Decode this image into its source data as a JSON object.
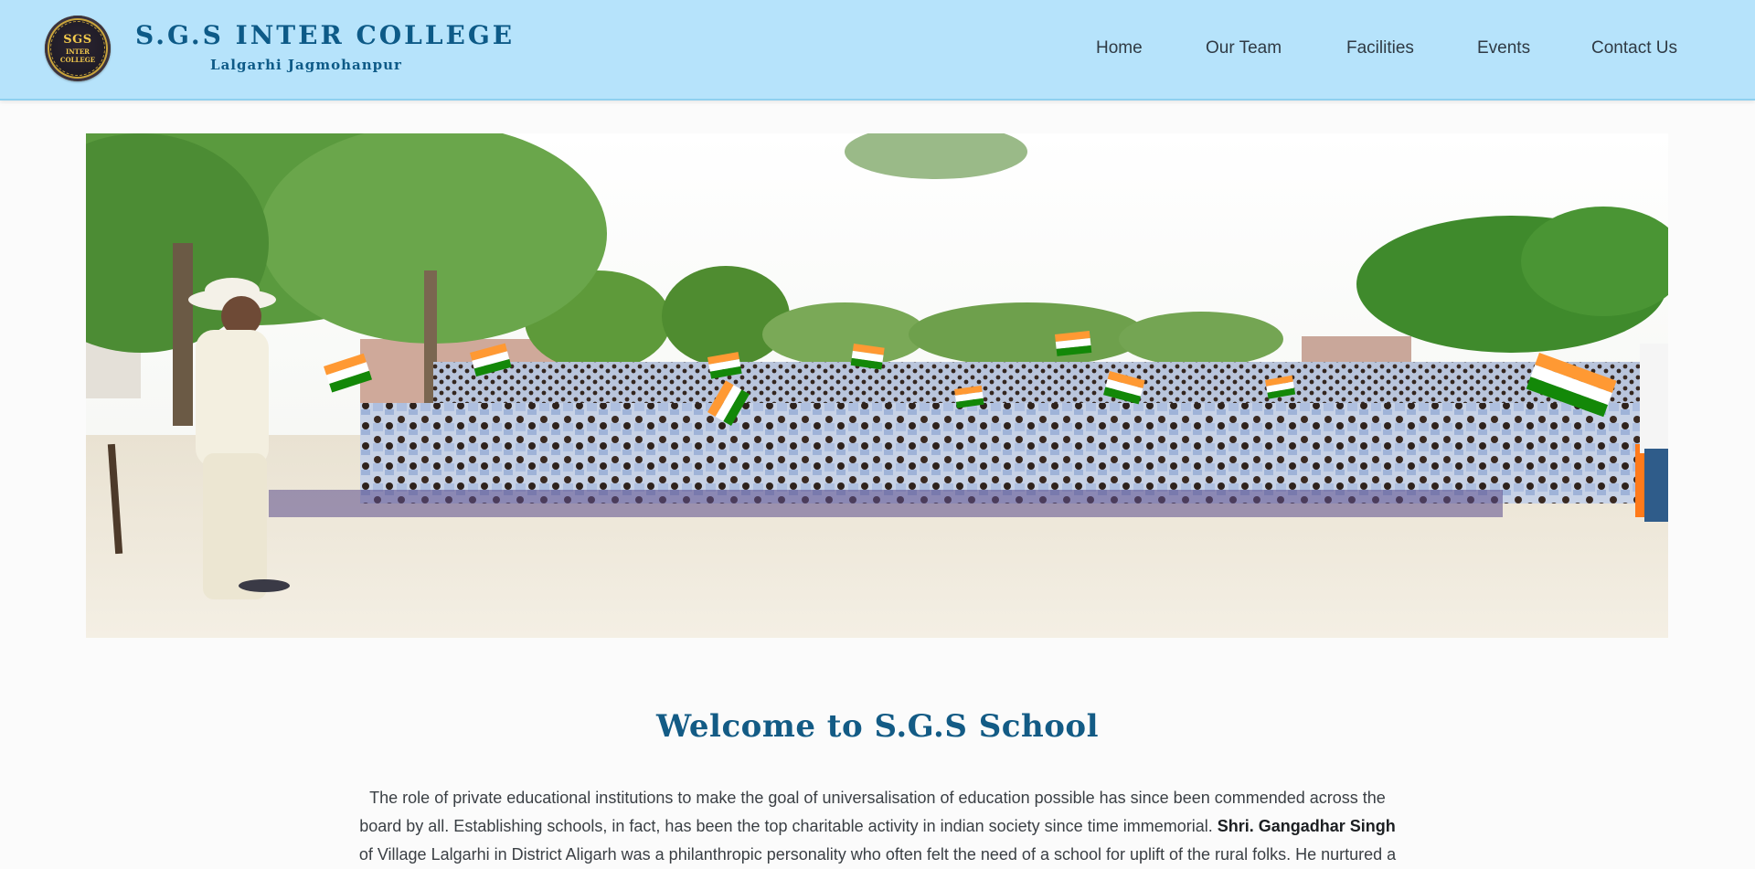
{
  "header": {
    "logo_text": {
      "line1": "SGS",
      "line2": "INTER",
      "line3": "COLLEGE"
    },
    "title": "S.G.S INTER COLLEGE",
    "subtitle": "Lalgarhi Jagmohanpur"
  },
  "nav": {
    "items": [
      {
        "label": "Home"
      },
      {
        "label": "Our Team"
      },
      {
        "label": "Facilities"
      },
      {
        "label": "Events"
      },
      {
        "label": "Contact Us"
      }
    ]
  },
  "hero": {
    "alt": "Students seated outdoors holding Indian flags"
  },
  "main": {
    "heading": "Welcome to S.G.S School",
    "intro_part1": "The role of private educational institutions to make the goal of universalisation of education possible has since been commended across the board by all. Establishing schools, in fact, has been the top charitable activity in indian society since time immemorial. ",
    "intro_name": "Shri. Gangadhar Singh",
    "intro_part2": " of Village Lalgarhi in District Aligarh was a philanthropic personality who often felt the need of a school for uplift of the rural folks. He nurtured a"
  },
  "colors": {
    "header_bg": "#b6e3fb",
    "brand": "#0d5a87",
    "heading": "#135b85",
    "body_text": "#3a3f44"
  }
}
